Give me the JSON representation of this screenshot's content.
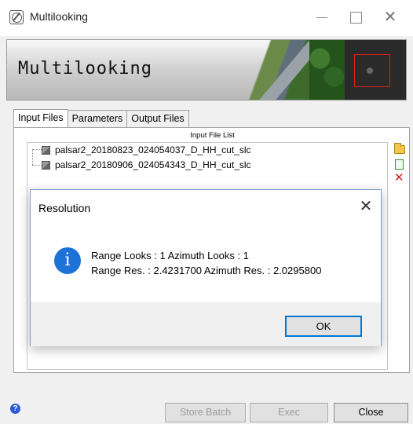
{
  "window": {
    "title": "Multilooking",
    "banner_title": "Multilooking"
  },
  "tabs": [
    {
      "label": "Input Files",
      "active": true
    },
    {
      "label": "Parameters",
      "active": false
    },
    {
      "label": "Output Files",
      "active": false
    }
  ],
  "input_list": {
    "caption": "Input File List",
    "files": [
      "palsar2_20180823_024054037_D_HH_cut_slc",
      "palsar2_20180906_024054343_D_HH_cut_slc"
    ]
  },
  "side_icons": [
    "folder-open-icon",
    "new-page-icon",
    "delete-x-icon"
  ],
  "buttons": {
    "store_batch": "Store Batch",
    "exec": "Exec",
    "close": "Close"
  },
  "dialog": {
    "title": "Resolution",
    "line1": "Range Looks : 1   Azimuth Looks : 1",
    "line2": "Range Res. : 2.4231700   Azimuth Res. : 2.0295800",
    "ok": "OK"
  },
  "colors": {
    "accent_focus": "#0078d7",
    "info_icon": "#1c72d6",
    "delete_red": "#d02020"
  }
}
